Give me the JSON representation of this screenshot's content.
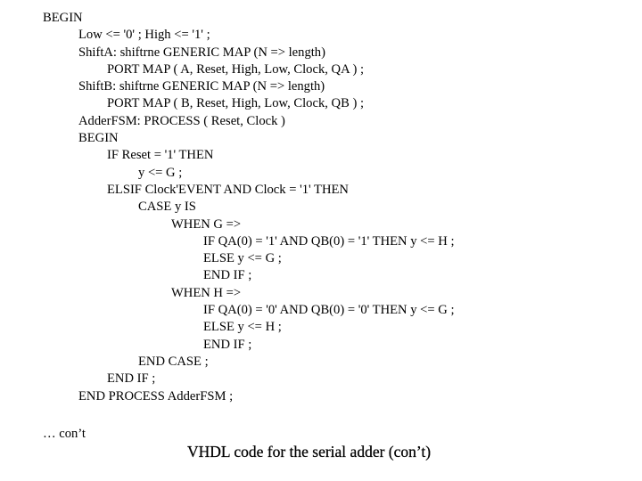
{
  "code": {
    "language": "VHDL",
    "lines": [
      {
        "indent": 0,
        "text": "BEGIN"
      },
      {
        "indent": 1,
        "text": "Low <= '0' ; High <= '1' ;"
      },
      {
        "indent": 1,
        "text": "ShiftA: shiftrne GENERIC MAP (N => length)"
      },
      {
        "indent": 2,
        "text": "PORT MAP ( A, Reset, High, Low, Clock, QA ) ;"
      },
      {
        "indent": 1,
        "text": "ShiftB: shiftrne GENERIC MAP (N => length)"
      },
      {
        "indent": 2,
        "text": "PORT MAP ( B, Reset, High, Low, Clock, QB ) ;"
      },
      {
        "indent": 1,
        "text": "AdderFSM: PROCESS ( Reset, Clock )"
      },
      {
        "indent": 1,
        "text": "BEGIN"
      },
      {
        "indent": 2,
        "text": "IF Reset = '1' THEN"
      },
      {
        "indent": 3,
        "text": "y <= G ;"
      },
      {
        "indent": 2,
        "text": "ELSIF Clock'EVENT AND Clock = '1' THEN"
      },
      {
        "indent": 3,
        "text": "CASE y IS"
      },
      {
        "indent": 4,
        "text": "WHEN G =>"
      },
      {
        "indent": 5,
        "text": "IF QA(0) = '1' AND QB(0) = '1' THEN y <= H ;"
      },
      {
        "indent": 5,
        "text": "ELSE y <= G ;"
      },
      {
        "indent": 5,
        "text": "END IF ;"
      },
      {
        "indent": 4,
        "text": "WHEN H =>"
      },
      {
        "indent": 5,
        "text": "IF QA(0) = '0' AND QB(0) = '0' THEN y <= G ;"
      },
      {
        "indent": 5,
        "text": "ELSE y <= H ;"
      },
      {
        "indent": 5,
        "text": "END IF ;"
      },
      {
        "indent": 3,
        "text": "END CASE ;"
      },
      {
        "indent": 2,
        "text": "END IF ;"
      },
      {
        "indent": 1,
        "text": "END PROCESS AdderFSM ;"
      }
    ]
  },
  "continued_note": "… con’t",
  "caption": "VHDL code for the serial adder (con’t)"
}
